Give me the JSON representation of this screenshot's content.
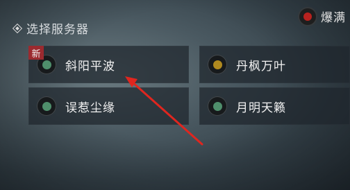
{
  "header": {
    "title": "选择服务器",
    "icon": "diamond-icon"
  },
  "legend": {
    "label": "爆满",
    "color": "#b8221f"
  },
  "servers": [
    {
      "name": "斜阳平波",
      "status_color": "#4f8f6c",
      "badge": "新"
    },
    {
      "name": "丹枫万叶",
      "status_color": "#b08a1f"
    },
    {
      "name": "误惹尘缘",
      "status_color": "#4f8f6c"
    },
    {
      "name": "月明天籁",
      "status_color": "#4f8f6c"
    }
  ],
  "colors": {
    "arrow": "#e0261f",
    "badge_bg": "#9b2a2f"
  }
}
